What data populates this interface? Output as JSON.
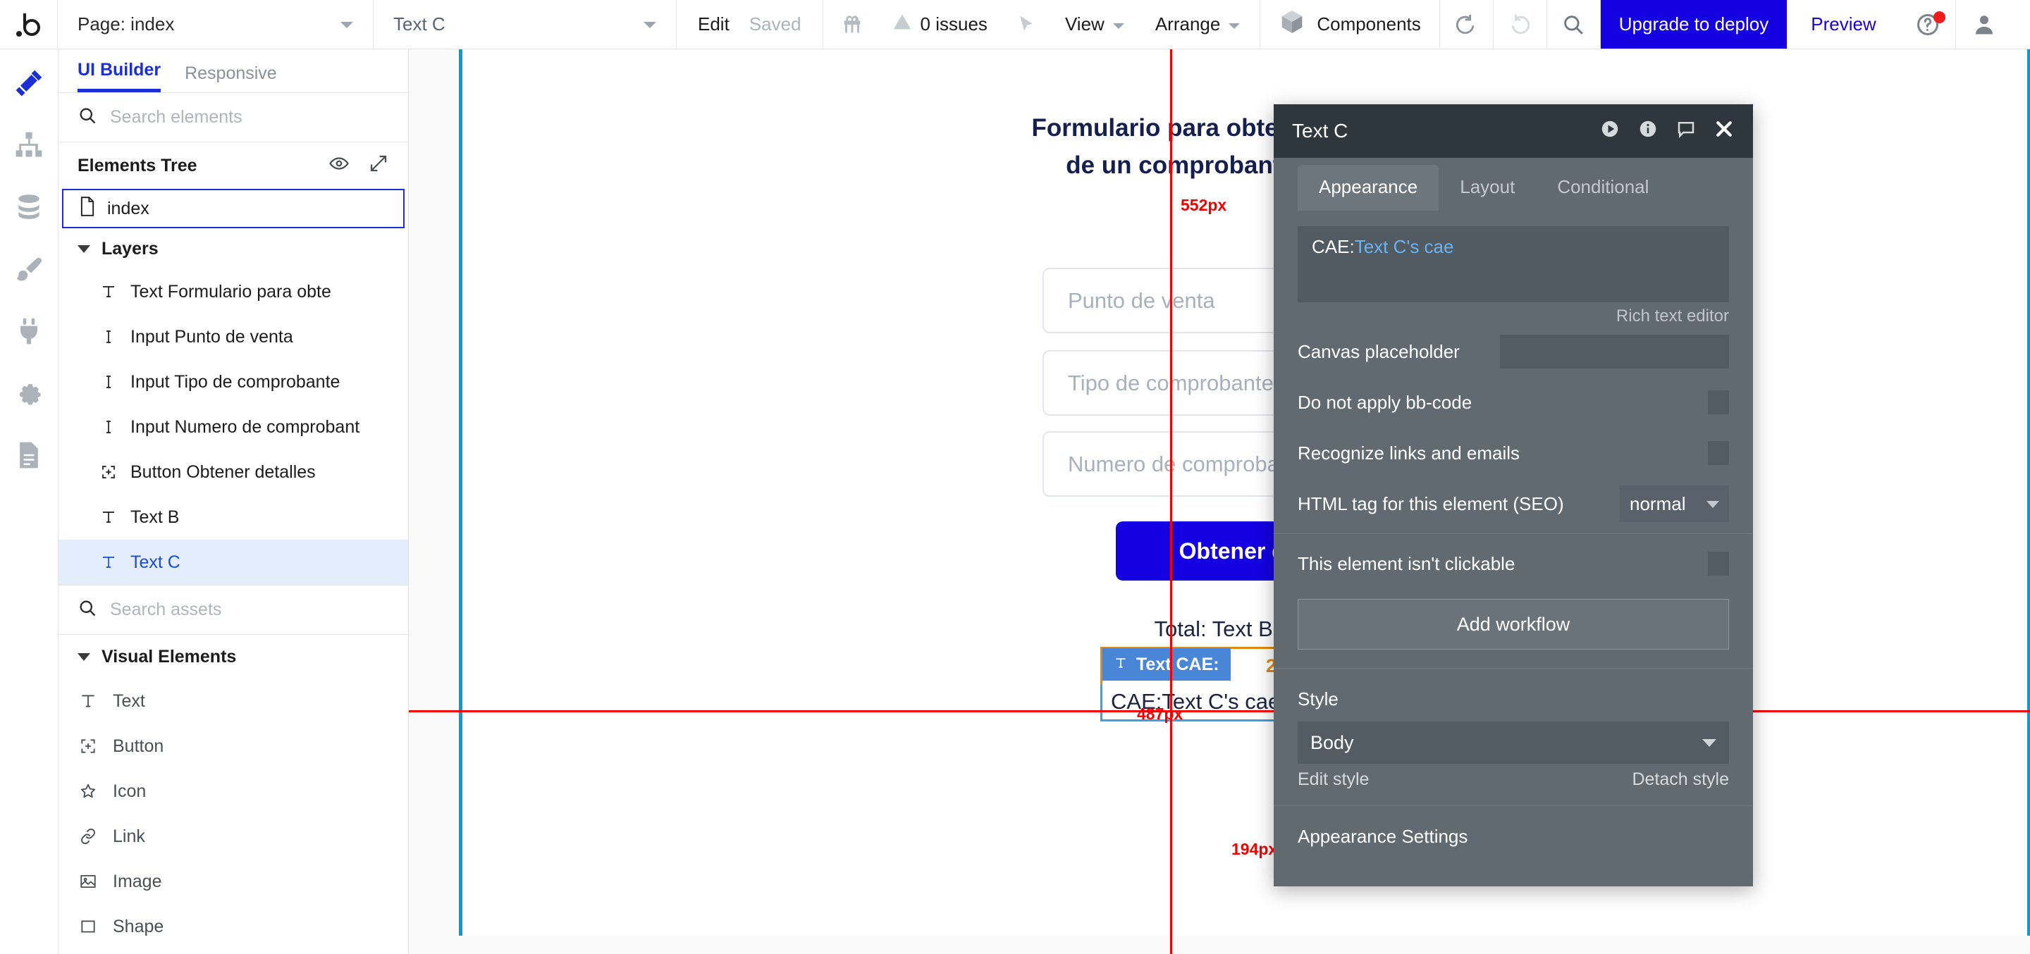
{
  "topbar": {
    "logo_icon": "bubble-logo-icon",
    "page_selector": "Page: index",
    "element_selector": "Text C",
    "edit_label": "Edit",
    "saved_label": "Saved",
    "gift_icon": "gift-icon",
    "issues_label": "0 issues",
    "warning_icon": "warning-triangle-icon",
    "cursor_icon": "cursor-arrow-icon",
    "view_label": "View",
    "arrange_label": "Arrange",
    "components_label": "Components",
    "components_icon": "cube-icon",
    "undo_icon": "undo-icon",
    "redo_icon": "redo-icon",
    "search_icon": "search-icon",
    "upgrade_label": "Upgrade to deploy",
    "preview_label": "Preview",
    "help_icon": "help-circle-icon",
    "avatar_icon": "user-avatar-icon",
    "accent_blue": "#1400e0"
  },
  "rail": {
    "items": [
      {
        "icon": "design-tools-icon",
        "active": true
      },
      {
        "icon": "workflow-icon",
        "active": false
      },
      {
        "icon": "data-icon",
        "active": false
      },
      {
        "icon": "styles-brush-icon",
        "active": false
      },
      {
        "icon": "plugins-plug-icon",
        "active": false
      },
      {
        "icon": "settings-gear-icon",
        "active": false
      },
      {
        "icon": "logs-document-icon",
        "active": false
      }
    ]
  },
  "left_panel": {
    "tabs": [
      {
        "label": "UI Builder",
        "active": true
      },
      {
        "label": "Responsive",
        "active": false
      }
    ],
    "search_elements_placeholder": "Search elements",
    "elements_tree_title": "Elements Tree",
    "eye_icon": "eye-icon",
    "expand_icon": "expand-arrows-icon",
    "root_item": {
      "label": "index",
      "icon": "page-document-icon"
    },
    "layers_group_label": "Layers",
    "layers": [
      {
        "label": "Text Formulario para obte",
        "icon": "text-icon",
        "selected": false
      },
      {
        "label": "Input Punto de venta",
        "icon": "input-icon",
        "selected": false
      },
      {
        "label": "Input Tipo de comprobante",
        "icon": "input-icon",
        "selected": false
      },
      {
        "label": "Input Numero de comprobant",
        "icon": "input-icon",
        "selected": false
      },
      {
        "label": "Button Obtener detalles",
        "icon": "button-icon",
        "selected": false
      },
      {
        "label": "Text B",
        "icon": "text-icon",
        "selected": false
      },
      {
        "label": "Text C",
        "icon": "text-icon",
        "selected": true
      }
    ],
    "search_assets_placeholder": "Search assets",
    "visual_elements_label": "Visual Elements",
    "visual_elements": [
      {
        "label": "Text",
        "icon": "text-icon"
      },
      {
        "label": "Button",
        "icon": "button-icon"
      },
      {
        "label": "Icon",
        "icon": "star-icon"
      },
      {
        "label": "Link",
        "icon": "link-icon"
      },
      {
        "label": "Image",
        "icon": "image-icon"
      },
      {
        "label": "Shape",
        "icon": "square-icon"
      }
    ]
  },
  "canvas": {
    "form_title_line1": "Formulario para obtener los detalles",
    "form_title_line2": "de un comprobante ya emitido",
    "fields": [
      {
        "placeholder": "Punto de venta"
      },
      {
        "placeholder": "Tipo de comprobante"
      },
      {
        "placeholder": "Numero de comprobante"
      }
    ],
    "cta_label": "Obtener detalles",
    "total_line": "Total: Text B's total",
    "selected_badge_label": "Text CAE:",
    "selected_badge_icon": "text-icon",
    "selected_badge_spacing": "20",
    "cae_text": "CAE:Text C's cae",
    "guides": {
      "label_552": "552px",
      "label_487": "487px",
      "label_194": "194px",
      "guide_color": "#f50000",
      "frame_border_color": "#0b9bd4"
    }
  },
  "property_panel": {
    "title": "Text C",
    "header_icons": [
      "play-circle-icon",
      "info-circle-icon",
      "comment-bubble-icon",
      "close-x-icon"
    ],
    "tabs": [
      {
        "label": "Appearance",
        "active": true
      },
      {
        "label": "Layout",
        "active": false
      },
      {
        "label": "Conditional",
        "active": false
      }
    ],
    "rich_text_prefix": "CAE:",
    "rich_text_token": "Text C's cae",
    "rich_text_editor_caption": "Rich text editor",
    "canvas_placeholder_label": "Canvas placeholder",
    "canvas_placeholder_value": "",
    "do_not_apply_bbcode_label": "Do not apply bb-code",
    "recognize_links_label": "Recognize links and emails",
    "html_tag_label": "HTML tag for this element (SEO)",
    "html_tag_value": "normal",
    "not_clickable_label": "This element isn't clickable",
    "add_workflow_label": "Add workflow",
    "style_section_label": "Style",
    "style_value": "Body",
    "edit_style_label": "Edit style",
    "detach_style_label": "Detach style",
    "appearance_settings_label": "Appearance Settings"
  }
}
